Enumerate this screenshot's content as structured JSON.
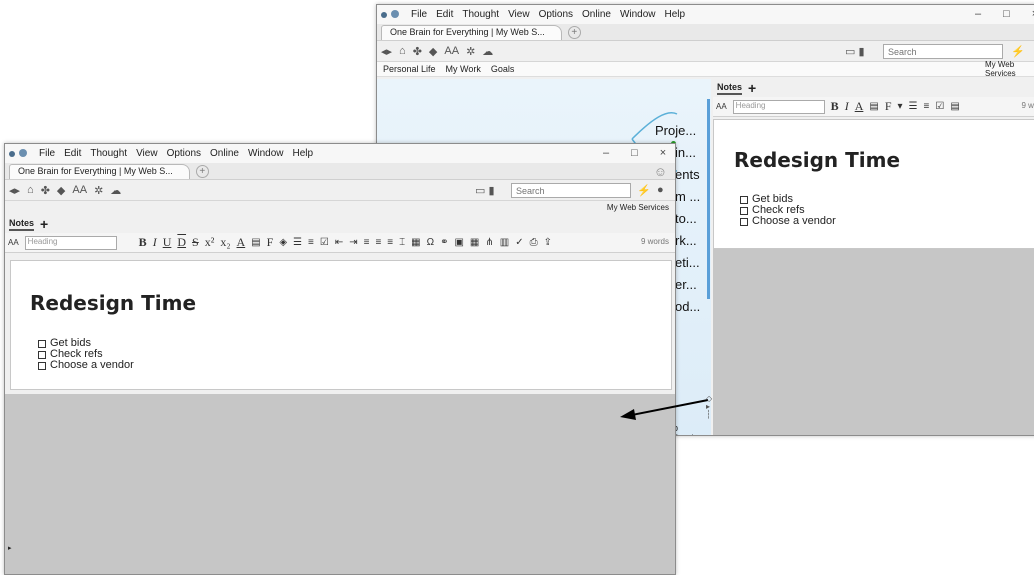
{
  "menu": [
    "File",
    "Edit",
    "Thought",
    "View",
    "Options",
    "Online",
    "Window",
    "Help"
  ],
  "tab_title": "One Brain for Everything | My Web S...",
  "search_placeholder": "Search",
  "my_web_services": "My Web Services",
  "bookmarks": [
    "Personal Life",
    "My Work",
    "Goals"
  ],
  "notes_tab": "Notes",
  "style_select": "Heading",
  "aa_label": "AA",
  "word_count": "9 words",
  "word_count_trunc": "9 wor",
  "notes_title": "Redesign Time",
  "checklist": [
    "Get bids",
    "Check refs",
    "Choose a vendor"
  ],
  "mindmap_nodes": [
    "Proje...",
    "in...",
    "ents",
    "m ...",
    "to...",
    "rk...",
    "eti...",
    "er...",
    "od..."
  ],
  "bottom_label": "b Servic...",
  "win_controls": [
    "–",
    "□",
    "×"
  ]
}
